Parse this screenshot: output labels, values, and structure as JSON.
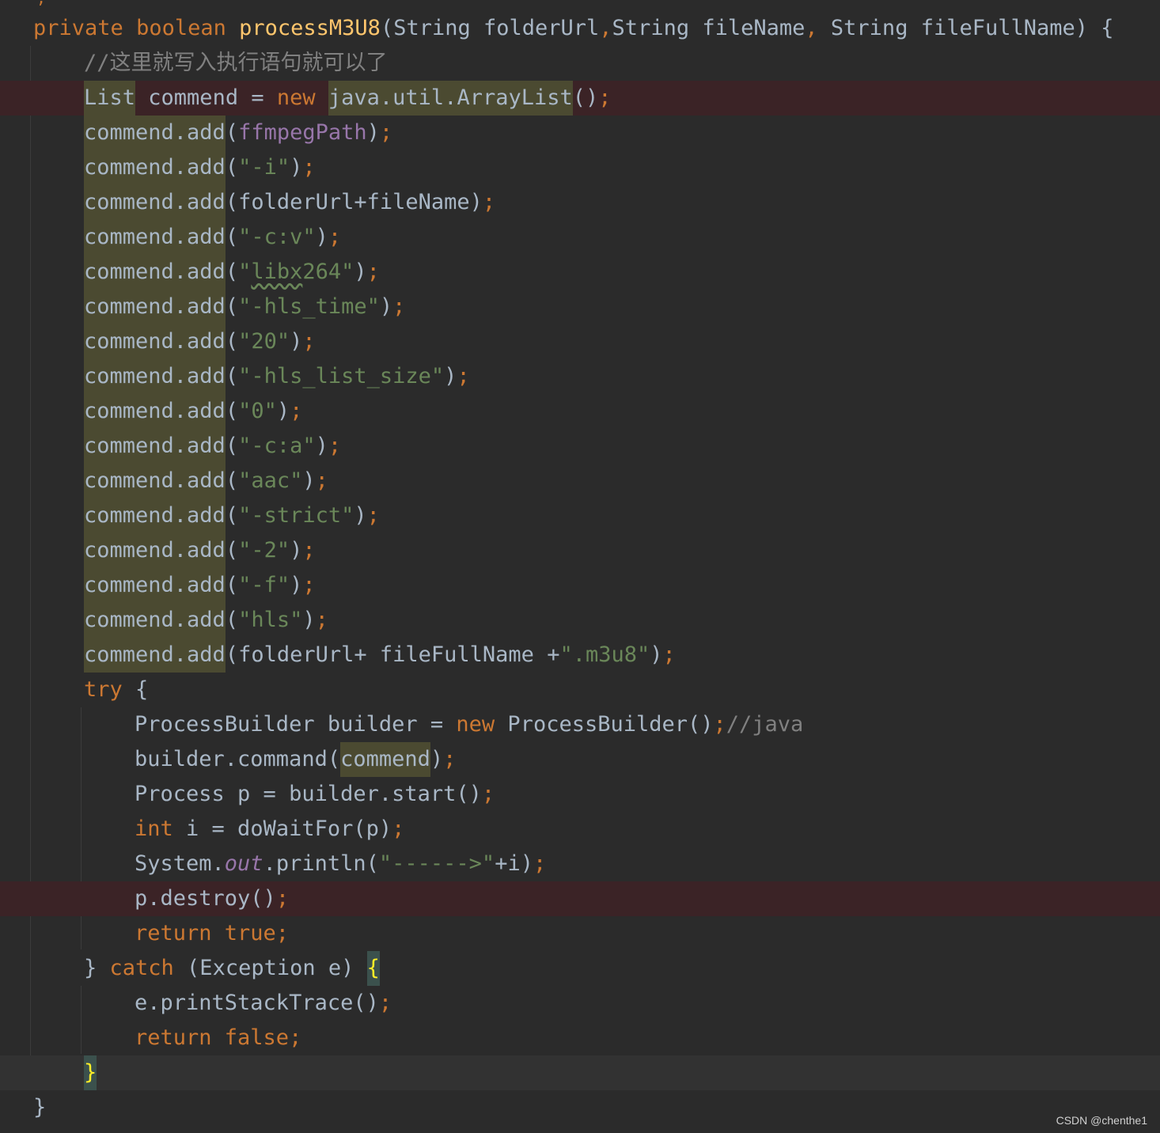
{
  "editor": {
    "language": "java",
    "theme_colors": {
      "background": "#2b2b2b",
      "keyword": "#cc7832",
      "method_declaration": "#ffc66d",
      "string": "#6a8759",
      "comment": "#808080",
      "field": "#9876aa",
      "plain": "#a9b7c6",
      "usage_highlight": "#4b4a31",
      "error_line": "#3b2326",
      "matched_brace": "#ffef28"
    },
    "lines": [
      {
        "indent": 1,
        "tokens": [
          {
            "t": "private",
            "k": "kw"
          },
          {
            "t": " ",
            "k": "plain"
          },
          {
            "t": "boolean",
            "k": "kw"
          },
          {
            "t": " ",
            "k": "plain"
          },
          {
            "t": "processM3U8",
            "k": "method-decl"
          },
          {
            "t": "(String folderUrl",
            "k": "plain"
          },
          {
            "t": ",",
            "k": "semi"
          },
          {
            "t": "String fileName",
            "k": "plain"
          },
          {
            "t": ",",
            "k": "semi"
          },
          {
            "t": " String fileFullName) {",
            "k": "plain"
          }
        ]
      },
      {
        "indent": 2,
        "tokens": [
          {
            "t": "//这里就写入执行语句就可以了",
            "k": "comment"
          }
        ]
      },
      {
        "indent": 2,
        "state": "error",
        "tokens": [
          {
            "t": "List",
            "k": "plain",
            "hl": true
          },
          {
            "t": " commend = ",
            "k": "plain"
          },
          {
            "t": "new",
            "k": "kw"
          },
          {
            "t": " ",
            "k": "plain"
          },
          {
            "t": "java.util.ArrayList",
            "k": "plain",
            "hl": true
          },
          {
            "t": "()",
            "k": "plain"
          },
          {
            "t": ";",
            "k": "semi"
          }
        ]
      },
      {
        "indent": 2,
        "tokens": [
          {
            "t": "commend.add",
            "k": "plain",
            "hl": true
          },
          {
            "t": "(",
            "k": "plain"
          },
          {
            "t": "ffmpegPath",
            "k": "field"
          },
          {
            "t": ")",
            "k": "plain"
          },
          {
            "t": ";",
            "k": "semi"
          }
        ]
      },
      {
        "indent": 2,
        "tokens": [
          {
            "t": "commend.add",
            "k": "plain",
            "hl": true
          },
          {
            "t": "(",
            "k": "plain"
          },
          {
            "t": "\"-i\"",
            "k": "string"
          },
          {
            "t": ")",
            "k": "plain"
          },
          {
            "t": ";",
            "k": "semi"
          }
        ]
      },
      {
        "indent": 2,
        "tokens": [
          {
            "t": "commend.add",
            "k": "plain",
            "hl": true
          },
          {
            "t": "(folderUrl+fileName)",
            "k": "plain"
          },
          {
            "t": ";",
            "k": "semi"
          }
        ]
      },
      {
        "indent": 2,
        "tokens": [
          {
            "t": "commend.add",
            "k": "plain",
            "hl": true
          },
          {
            "t": "(",
            "k": "plain"
          },
          {
            "t": "\"-c:v\"",
            "k": "string"
          },
          {
            "t": ")",
            "k": "plain"
          },
          {
            "t": ";",
            "k": "semi"
          }
        ]
      },
      {
        "indent": 2,
        "tokens": [
          {
            "t": "commend.add",
            "k": "plain",
            "hl": true
          },
          {
            "t": "(",
            "k": "plain"
          },
          {
            "t": "\"",
            "k": "string"
          },
          {
            "t": "libx",
            "k": "string",
            "typo": true
          },
          {
            "t": "264\"",
            "k": "string"
          },
          {
            "t": ")",
            "k": "plain"
          },
          {
            "t": ";",
            "k": "semi"
          }
        ]
      },
      {
        "indent": 2,
        "tokens": [
          {
            "t": "commend.add",
            "k": "plain",
            "hl": true
          },
          {
            "t": "(",
            "k": "plain"
          },
          {
            "t": "\"-hls_time\"",
            "k": "string"
          },
          {
            "t": ")",
            "k": "plain"
          },
          {
            "t": ";",
            "k": "semi"
          }
        ]
      },
      {
        "indent": 2,
        "tokens": [
          {
            "t": "commend.add",
            "k": "plain",
            "hl": true
          },
          {
            "t": "(",
            "k": "plain"
          },
          {
            "t": "\"20\"",
            "k": "string"
          },
          {
            "t": ")",
            "k": "plain"
          },
          {
            "t": ";",
            "k": "semi"
          }
        ]
      },
      {
        "indent": 2,
        "tokens": [
          {
            "t": "commend.add",
            "k": "plain",
            "hl": true
          },
          {
            "t": "(",
            "k": "plain"
          },
          {
            "t": "\"-hls_list_size\"",
            "k": "string"
          },
          {
            "t": ")",
            "k": "plain"
          },
          {
            "t": ";",
            "k": "semi"
          }
        ]
      },
      {
        "indent": 2,
        "tokens": [
          {
            "t": "commend.add",
            "k": "plain",
            "hl": true
          },
          {
            "t": "(",
            "k": "plain"
          },
          {
            "t": "\"0\"",
            "k": "string"
          },
          {
            "t": ")",
            "k": "plain"
          },
          {
            "t": ";",
            "k": "semi"
          }
        ]
      },
      {
        "indent": 2,
        "tokens": [
          {
            "t": "commend.add",
            "k": "plain",
            "hl": true
          },
          {
            "t": "(",
            "k": "plain"
          },
          {
            "t": "\"-c:a\"",
            "k": "string"
          },
          {
            "t": ")",
            "k": "plain"
          },
          {
            "t": ";",
            "k": "semi"
          }
        ]
      },
      {
        "indent": 2,
        "tokens": [
          {
            "t": "commend.add",
            "k": "plain",
            "hl": true
          },
          {
            "t": "(",
            "k": "plain"
          },
          {
            "t": "\"aac\"",
            "k": "string"
          },
          {
            "t": ")",
            "k": "plain"
          },
          {
            "t": ";",
            "k": "semi"
          }
        ]
      },
      {
        "indent": 2,
        "tokens": [
          {
            "t": "commend.add",
            "k": "plain",
            "hl": true
          },
          {
            "t": "(",
            "k": "plain"
          },
          {
            "t": "\"-strict\"",
            "k": "string"
          },
          {
            "t": ")",
            "k": "plain"
          },
          {
            "t": ";",
            "k": "semi"
          }
        ]
      },
      {
        "indent": 2,
        "tokens": [
          {
            "t": "commend.add",
            "k": "plain",
            "hl": true
          },
          {
            "t": "(",
            "k": "plain"
          },
          {
            "t": "\"-2\"",
            "k": "string"
          },
          {
            "t": ")",
            "k": "plain"
          },
          {
            "t": ";",
            "k": "semi"
          }
        ]
      },
      {
        "indent": 2,
        "tokens": [
          {
            "t": "commend.add",
            "k": "plain",
            "hl": true
          },
          {
            "t": "(",
            "k": "plain"
          },
          {
            "t": "\"-f\"",
            "k": "string"
          },
          {
            "t": ")",
            "k": "plain"
          },
          {
            "t": ";",
            "k": "semi"
          }
        ]
      },
      {
        "indent": 2,
        "tokens": [
          {
            "t": "commend.add",
            "k": "plain",
            "hl": true
          },
          {
            "t": "(",
            "k": "plain"
          },
          {
            "t": "\"hls\"",
            "k": "string"
          },
          {
            "t": ")",
            "k": "plain"
          },
          {
            "t": ";",
            "k": "semi"
          }
        ]
      },
      {
        "indent": 2,
        "tokens": [
          {
            "t": "commend.add",
            "k": "plain",
            "hl": true
          },
          {
            "t": "(folderUrl+ fileFullName +",
            "k": "plain"
          },
          {
            "t": "\".m3u8\"",
            "k": "string"
          },
          {
            "t": ")",
            "k": "plain"
          },
          {
            "t": ";",
            "k": "semi"
          }
        ]
      },
      {
        "indent": 2,
        "tokens": [
          {
            "t": "try",
            "k": "kw"
          },
          {
            "t": " {",
            "k": "plain"
          }
        ]
      },
      {
        "indent": 3,
        "tokens": [
          {
            "t": "ProcessBuilder builder = ",
            "k": "plain"
          },
          {
            "t": "new",
            "k": "kw"
          },
          {
            "t": " ProcessBuilder()",
            "k": "plain"
          },
          {
            "t": ";",
            "k": "semi"
          },
          {
            "t": "//java",
            "k": "comment"
          }
        ]
      },
      {
        "indent": 3,
        "tokens": [
          {
            "t": "builder.command(",
            "k": "plain"
          },
          {
            "t": "commend",
            "k": "plain",
            "hl": true
          },
          {
            "t": ")",
            "k": "plain"
          },
          {
            "t": ";",
            "k": "semi"
          }
        ]
      },
      {
        "indent": 3,
        "tokens": [
          {
            "t": "Process p = builder.start()",
            "k": "plain"
          },
          {
            "t": ";",
            "k": "semi"
          }
        ]
      },
      {
        "indent": 3,
        "tokens": [
          {
            "t": "int",
            "k": "kw"
          },
          {
            "t": " i = doWaitFor(p)",
            "k": "plain"
          },
          {
            "t": ";",
            "k": "semi"
          }
        ]
      },
      {
        "indent": 3,
        "tokens": [
          {
            "t": "System.",
            "k": "plain"
          },
          {
            "t": "out",
            "k": "static"
          },
          {
            "t": ".println(",
            "k": "plain"
          },
          {
            "t": "\"------>\"",
            "k": "string"
          },
          {
            "t": "+i)",
            "k": "plain"
          },
          {
            "t": ";",
            "k": "semi"
          }
        ]
      },
      {
        "indent": 3,
        "state": "error",
        "tokens": [
          {
            "t": "p.destroy()",
            "k": "plain"
          },
          {
            "t": ";",
            "k": "semi"
          }
        ]
      },
      {
        "indent": 3,
        "tokens": [
          {
            "t": "return true;",
            "k": "kw"
          }
        ]
      },
      {
        "indent": 2,
        "tokens": [
          {
            "t": "} ",
            "k": "plain"
          },
          {
            "t": "catch",
            "k": "kw"
          },
          {
            "t": " (Exception e) ",
            "k": "plain"
          },
          {
            "t": "{",
            "k": "brace-match"
          }
        ]
      },
      {
        "indent": 3,
        "tokens": [
          {
            "t": "e.printStackTrace()",
            "k": "plain"
          },
          {
            "t": ";",
            "k": "semi"
          }
        ]
      },
      {
        "indent": 3,
        "tokens": [
          {
            "t": "return false;",
            "k": "kw"
          }
        ]
      },
      {
        "indent": 2,
        "state": "caret",
        "tokens": [
          {
            "t": "}",
            "k": "brace-match"
          }
        ]
      },
      {
        "indent": 1,
        "tokens": [
          {
            "t": "}",
            "k": "plain"
          }
        ]
      }
    ]
  },
  "watermark": "CSDN @chenthe1"
}
